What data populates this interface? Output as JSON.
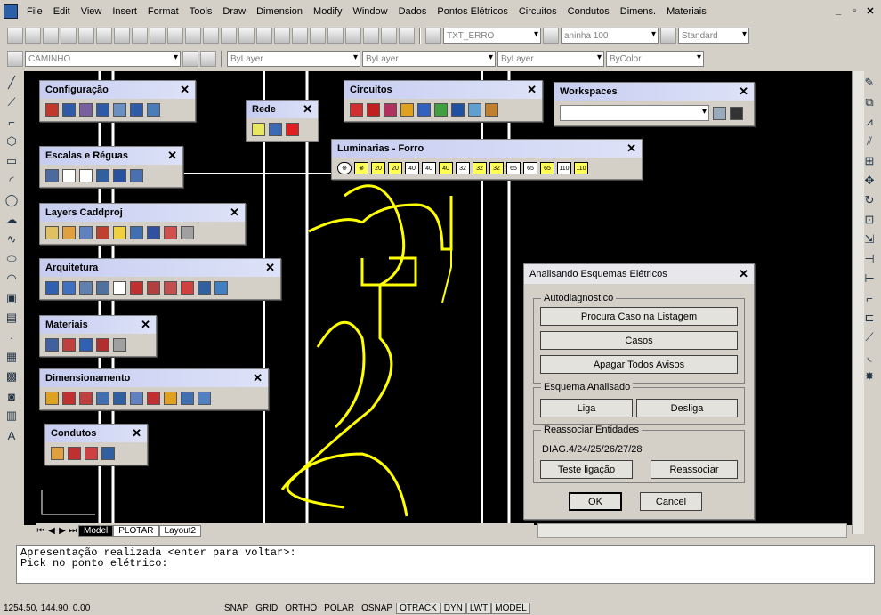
{
  "menu": [
    "File",
    "Edit",
    "View",
    "Insert",
    "Format",
    "Tools",
    "Draw",
    "Dimension",
    "Modify",
    "Window",
    "Dados",
    "Pontos Elétricos",
    "Circuitos",
    "Condutos",
    "Dimens.",
    "Materiais"
  ],
  "toolbar": {
    "txt_combo": "TXT_ERRO",
    "size_combo": "aninha 100",
    "style_combo": "Standard",
    "layer_combo": "CAMINHO",
    "color_combo": "ByLayer",
    "linetype_combo": "ByLayer",
    "lineweight_combo": "ByLayer",
    "plotstyle_combo": "ByColor"
  },
  "palettes": {
    "configuracao": "Configuração",
    "rede": "Rede",
    "circuitos": "Circuitos",
    "workspaces": "Workspaces",
    "luminarias": "Luminarias - Forro",
    "escalas": "Escalas e Réguas",
    "layers": "Layers Caddproj",
    "arquitetura": "Arquitetura",
    "materiais": "Materiais",
    "dimensionamento": "Dimensionamento",
    "condutos": "Condutos"
  },
  "luminaria_labels": [
    "20",
    "20",
    "40",
    "40",
    "40",
    "32",
    "32",
    "32",
    "65",
    "65",
    "65",
    "110",
    "110"
  ],
  "dialog": {
    "title": "Analisando Esquemas Elétricos",
    "group_autodiag": "Autodiagnostico",
    "btn_procura": "Procura Caso na Listagem",
    "btn_casos": "Casos",
    "btn_apagar": "Apagar Todos Avisos",
    "group_esquema": "Esquema Analisado",
    "btn_liga": "Liga",
    "btn_desliga": "Desliga",
    "group_reassociar": "Reassociar Entidades",
    "diag_text": "DIAG.4/24/25/26/27/28",
    "btn_teste": "Teste ligação",
    "btn_reassociar": "Reassociar",
    "btn_ok": "OK",
    "btn_cancel": "Cancel"
  },
  "tabs": [
    "Model",
    "PLOTAR",
    "Layout2"
  ],
  "command": {
    "line1": "Apresentação realizada <enter para voltar>:",
    "line2": "Pick no ponto elétrico:"
  },
  "status": {
    "coords": "1254.50, 144.90, 0.00",
    "buttons": [
      "SNAP",
      "GRID",
      "ORTHO",
      "POLAR",
      "OSNAP",
      "OTRACK",
      "DYN",
      "LWT",
      "MODEL"
    ]
  }
}
